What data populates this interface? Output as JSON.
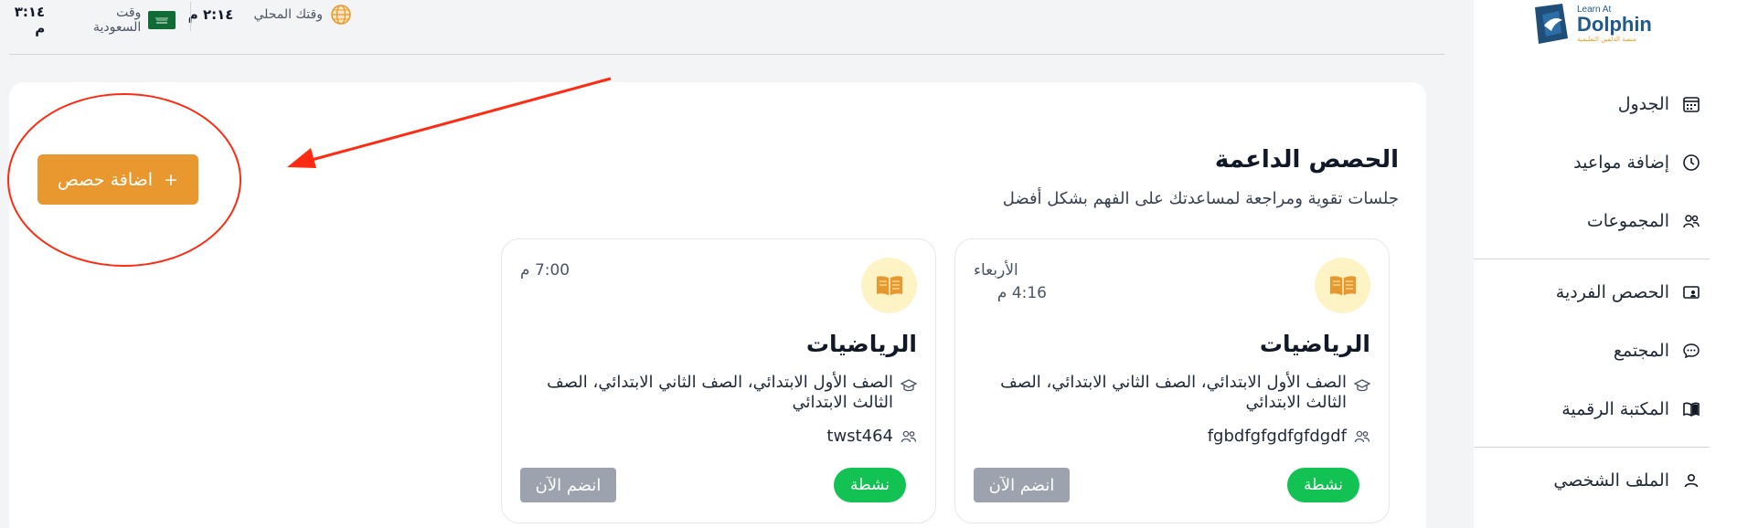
{
  "header": {
    "local_time_label": "وقتك المحلي",
    "local_time_value": "٢:١٤ م",
    "saudi_time_label": "وقت السعودية",
    "saudi_time_value": "٣:١٤ م"
  },
  "logo": {
    "small": "Learn At",
    "big": "Dolphin",
    "sub": "منصة الدلفين التعليمية"
  },
  "sidebar": {
    "items": [
      {
        "label": "الجدول",
        "icon": "calendar-icon"
      },
      {
        "label": "إضافة مواعيد",
        "icon": "clock-icon"
      },
      {
        "label": "المجموعات",
        "icon": "users-icon"
      },
      {
        "label": "الحصص الفردية",
        "icon": "video-icon"
      },
      {
        "label": "المجتمع",
        "icon": "chat-icon"
      },
      {
        "label": "المكتبة الرقمية",
        "icon": "book-icon"
      },
      {
        "label": "الملف الشخصي",
        "icon": "user-icon"
      }
    ]
  },
  "main": {
    "title": "الحصص الداعمة",
    "subtitle": "جلسات تقوية ومراجعة لمساعدتك على الفهم بشكل أفضل",
    "add_button": "اضافة حصص",
    "add_icon": "+"
  },
  "cards": [
    {
      "day": "الأربعاء",
      "time": "4:16 م",
      "title": "الرياضيات",
      "grades": "الصف الأول الابتدائي، الصف الثاني الابتدائي، الصف الثالث الابتدائي",
      "group": "fgbdfgfgdfgfdgdf",
      "status": "نشطة",
      "join": "انضم الآن"
    },
    {
      "time": "7:00 م",
      "title": "الرياضيات",
      "grades": "الصف الأول الابتدائي، الصف الثاني الابتدائي، الصف الثالث الابتدائي",
      "group": "twst464",
      "status": "نشطة",
      "join": "انضم الآن"
    }
  ],
  "colors": {
    "accent": "#e8982e",
    "active": "#12c252",
    "disabled": "#9ca3af",
    "annotation": "#ff2a12",
    "brand": "#1f5a8a"
  }
}
